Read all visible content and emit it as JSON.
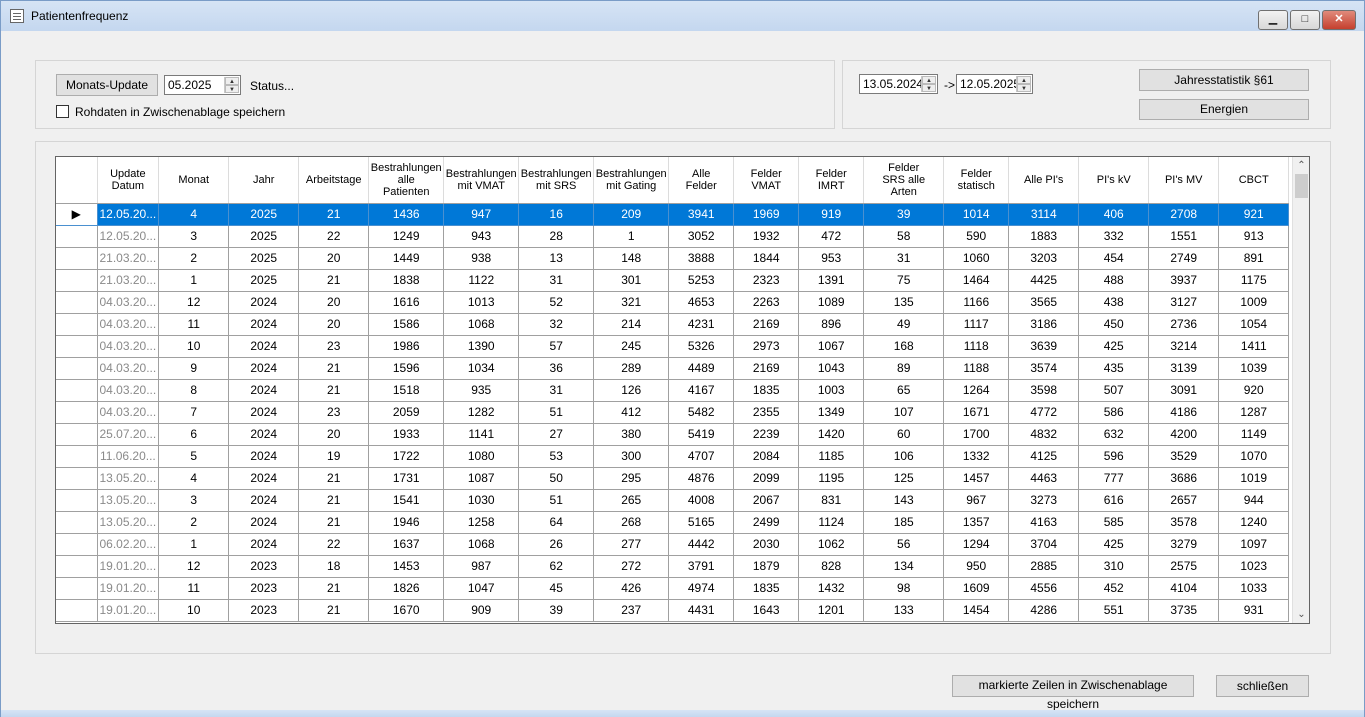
{
  "window": {
    "title": "Patientenfrequenz",
    "min_glyph": "▁",
    "max_glyph": "□",
    "close_glyph": "✕"
  },
  "update_panel": {
    "button_label": "Monats-Update",
    "month_value": "05.2025",
    "status_text": "Status...",
    "checkbox_label": "Rohdaten in Zwischenablage speichern",
    "checkbox_checked": false
  },
  "range_panel": {
    "from_date": "13.05.2024",
    "arrow": "->",
    "to_date": "12.05.2025",
    "jahresstatistik_label": "Jahresstatistik §61",
    "energien_label": "Energien"
  },
  "grid": {
    "columns": [
      "",
      "Update\nDatum",
      "Monat",
      "Jahr",
      "Arbeitstage",
      "Bestrahlungen\nalle\nPatienten",
      "Bestrahlungen\nmit VMAT",
      "Bestrahlungen\nmit SRS",
      "Bestrahlungen\nmit Gating",
      "Alle\nFelder",
      "Felder\nVMAT",
      "Felder\nIMRT",
      "Felder\nSRS alle\nArten",
      "Felder\nstatisch",
      "Alle PI's",
      "PI's kV",
      "PI's MV",
      "CBCT"
    ],
    "selected_row": 0,
    "row_marker": "▶",
    "rows": [
      [
        "12.05.20...",
        "4",
        "2025",
        "21",
        "1436",
        "947",
        "16",
        "209",
        "3941",
        "1969",
        "919",
        "39",
        "1014",
        "3114",
        "406",
        "2708",
        "921"
      ],
      [
        "12.05.20...",
        "3",
        "2025",
        "22",
        "1249",
        "943",
        "28",
        "1",
        "3052",
        "1932",
        "472",
        "58",
        "590",
        "1883",
        "332",
        "1551",
        "913"
      ],
      [
        "21.03.20...",
        "2",
        "2025",
        "20",
        "1449",
        "938",
        "13",
        "148",
        "3888",
        "1844",
        "953",
        "31",
        "1060",
        "3203",
        "454",
        "2749",
        "891"
      ],
      [
        "21.03.20...",
        "1",
        "2025",
        "21",
        "1838",
        "1122",
        "31",
        "301",
        "5253",
        "2323",
        "1391",
        "75",
        "1464",
        "4425",
        "488",
        "3937",
        "1175"
      ],
      [
        "04.03.20...",
        "12",
        "2024",
        "20",
        "1616",
        "1013",
        "52",
        "321",
        "4653",
        "2263",
        "1089",
        "135",
        "1166",
        "3565",
        "438",
        "3127",
        "1009"
      ],
      [
        "04.03.20...",
        "11",
        "2024",
        "20",
        "1586",
        "1068",
        "32",
        "214",
        "4231",
        "2169",
        "896",
        "49",
        "1117",
        "3186",
        "450",
        "2736",
        "1054"
      ],
      [
        "04.03.20...",
        "10",
        "2024",
        "23",
        "1986",
        "1390",
        "57",
        "245",
        "5326",
        "2973",
        "1067",
        "168",
        "1118",
        "3639",
        "425",
        "3214",
        "1411"
      ],
      [
        "04.03.20...",
        "9",
        "2024",
        "21",
        "1596",
        "1034",
        "36",
        "289",
        "4489",
        "2169",
        "1043",
        "89",
        "1188",
        "3574",
        "435",
        "3139",
        "1039"
      ],
      [
        "04.03.20...",
        "8",
        "2024",
        "21",
        "1518",
        "935",
        "31",
        "126",
        "4167",
        "1835",
        "1003",
        "65",
        "1264",
        "3598",
        "507",
        "3091",
        "920"
      ],
      [
        "04.03.20...",
        "7",
        "2024",
        "23",
        "2059",
        "1282",
        "51",
        "412",
        "5482",
        "2355",
        "1349",
        "107",
        "1671",
        "4772",
        "586",
        "4186",
        "1287"
      ],
      [
        "25.07.20...",
        "6",
        "2024",
        "20",
        "1933",
        "1141",
        "27",
        "380",
        "5419",
        "2239",
        "1420",
        "60",
        "1700",
        "4832",
        "632",
        "4200",
        "1149"
      ],
      [
        "11.06.20...",
        "5",
        "2024",
        "19",
        "1722",
        "1080",
        "53",
        "300",
        "4707",
        "2084",
        "1185",
        "106",
        "1332",
        "4125",
        "596",
        "3529",
        "1070"
      ],
      [
        "13.05.20...",
        "4",
        "2024",
        "21",
        "1731",
        "1087",
        "50",
        "295",
        "4876",
        "2099",
        "1195",
        "125",
        "1457",
        "4463",
        "777",
        "3686",
        "1019"
      ],
      [
        "13.05.20...",
        "3",
        "2024",
        "21",
        "1541",
        "1030",
        "51",
        "265",
        "4008",
        "2067",
        "831",
        "143",
        "967",
        "3273",
        "616",
        "2657",
        "944"
      ],
      [
        "13.05.20...",
        "2",
        "2024",
        "21",
        "1946",
        "1258",
        "64",
        "268",
        "5165",
        "2499",
        "1124",
        "185",
        "1357",
        "4163",
        "585",
        "3578",
        "1240"
      ],
      [
        "06.02.20...",
        "1",
        "2024",
        "22",
        "1637",
        "1068",
        "26",
        "277",
        "4442",
        "2030",
        "1062",
        "56",
        "1294",
        "3704",
        "425",
        "3279",
        "1097"
      ],
      [
        "19.01.20...",
        "12",
        "2023",
        "18",
        "1453",
        "987",
        "62",
        "272",
        "3791",
        "1879",
        "828",
        "134",
        "950",
        "2885",
        "310",
        "2575",
        "1023"
      ],
      [
        "19.01.20...",
        "11",
        "2023",
        "21",
        "1826",
        "1047",
        "45",
        "426",
        "4974",
        "1835",
        "1432",
        "98",
        "1609",
        "4556",
        "452",
        "4104",
        "1033"
      ],
      [
        "19.01.20...",
        "10",
        "2023",
        "21",
        "1670",
        "909",
        "39",
        "237",
        "4431",
        "1643",
        "1201",
        "133",
        "1454",
        "4286",
        "551",
        "3735",
        "931"
      ]
    ]
  },
  "footer": {
    "copy_rows_label": "markierte Zeilen in Zwischenablage speichern",
    "close_label": "schließen"
  }
}
